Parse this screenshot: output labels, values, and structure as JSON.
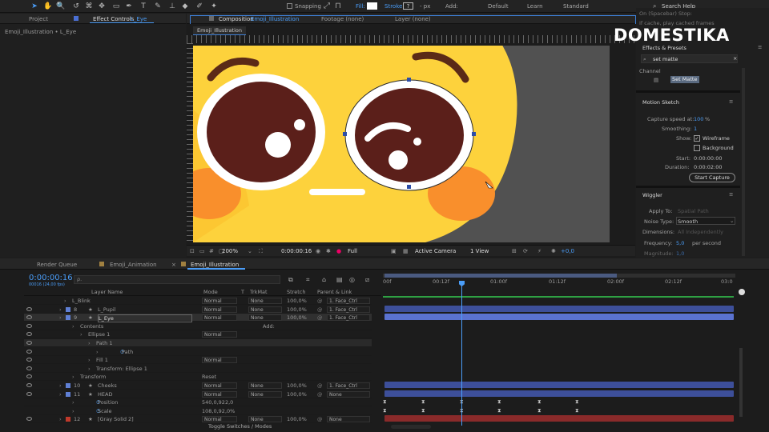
{
  "toolbar": {
    "snapping": "Snapping",
    "fill": "Fill:",
    "stroke": "Stroke:",
    "stroke_val": "?",
    "px": "- px",
    "add": "Add:",
    "workspaces": [
      "Default",
      "Learn",
      "Standard"
    ],
    "search": "Search Help"
  },
  "left_panel": {
    "tab_project": "Project",
    "tab_effect": "Effect Controls",
    "tab_effect_layer": "L_Eye",
    "breadcrumb": "Emoji_Illustration • L_Eye"
  },
  "comp_panel": {
    "tab_comp": "Composition",
    "comp_name": "Emoji_Illustration",
    "tab_footage": "Footage (none)",
    "tab_layer": "Layer (none)",
    "subtab": "Emoji_Illustration",
    "zoom": "200%",
    "time": "0:00:00:16",
    "res": "Full",
    "camera": "Active Camera",
    "view": "1 View",
    "exposure": "+0,0"
  },
  "right_panel": {
    "header1": "On (Spacebar) Stop:",
    "header2": "If cache, play cached frames",
    "logo": "DOMESTIKA",
    "effects_title": "Effects & Presets",
    "search_val": "set matte",
    "channel": "Channel",
    "set_matte": "Set Matte",
    "motion_sketch": {
      "title": "Motion Sketch",
      "capture_speed_label": "Capture speed at:",
      "capture_speed_val": "100",
      "capture_speed_unit": "%",
      "smoothing_label": "Smoothing:",
      "smoothing_val": "1",
      "show_label": "Show:",
      "wireframe": "Wireframe",
      "background": "Background",
      "start_label": "Start:",
      "start_val": "0:00:00:00",
      "duration_label": "Duration:",
      "duration_val": "0:00:02:00",
      "button": "Start Capture"
    },
    "wiggler": {
      "title": "Wiggler",
      "apply_label": "Apply To:",
      "apply_val": "Spatial Path",
      "noise_label": "Noise Type:",
      "noise_val": "Smooth",
      "dim_label": "Dimensions:",
      "dim_val": "All Independently",
      "freq_label": "Frequency:",
      "freq_val": "5,0",
      "freq_unit": "per second",
      "mag_label": "Magnitude:",
      "mag_val": "1,0"
    }
  },
  "timeline": {
    "tabs": [
      "Render Queue",
      "Emoji_Animation",
      "Emoji_Illustration"
    ],
    "timecode": "0:00:00:16",
    "fps": "00016 (24,00 fps)",
    "search_placeholder": "ρ.",
    "headers": {
      "layer_name": "Layer Name",
      "mode": "Mode",
      "t": "T",
      "trkmat": "TrkMat",
      "stretch": "Stretch",
      "parent": "Parent & Link"
    },
    "ruler": [
      "00f",
      "00:12f",
      "01:00f",
      "01:12f",
      "02:00f",
      "02:12f",
      "03:0"
    ],
    "footer": "Toggle Switches / Modes",
    "rows": [
      {
        "num": "",
        "name": "L_Blink",
        "mode": "Normal",
        "trk": "None",
        "stretch": "100,0%",
        "parent": "1. Face_Ctrl",
        "color": "#5f7fd4"
      },
      {
        "num": "8",
        "name": "L_Pupil",
        "mode": "Normal",
        "trk": "None",
        "stretch": "100,0%",
        "parent": "1. Face_Ctrl",
        "color": "#5f7fd4"
      },
      {
        "num": "9",
        "name": "L_Eye",
        "mode": "Normal",
        "trk": "None",
        "stretch": "100,0%",
        "parent": "1. Face_Ctrl",
        "color": "#5f7fd4"
      },
      {
        "num": "",
        "name": "Contents",
        "mode": "",
        "add": "Add:"
      },
      {
        "num": "",
        "name": "Ellipse 1",
        "mode": "Normal"
      },
      {
        "num": "",
        "name": "Path 1",
        "mode": ""
      },
      {
        "num": "",
        "name": "Path",
        "mode": ""
      },
      {
        "num": "",
        "name": "Fill 1",
        "mode": "Normal"
      },
      {
        "num": "",
        "name": "Transform: Ellipse 1",
        "mode": ""
      },
      {
        "num": "",
        "name": "Transform",
        "mode": "",
        "reset": "Reset"
      },
      {
        "num": "10",
        "name": "Cheeks",
        "mode": "Normal",
        "trk": "None",
        "stretch": "100,0%",
        "parent": "1. Face_Ctrl",
        "color": "#5f7fd4"
      },
      {
        "num": "11",
        "name": "HEAD",
        "mode": "Normal",
        "trk": "None",
        "stretch": "100,0%",
        "parent": "None",
        "color": "#5f7fd4"
      },
      {
        "num": "",
        "name": "Position",
        "mode": "",
        "val": "540,0,922,0"
      },
      {
        "num": "",
        "name": "Scale",
        "mode": "",
        "val": "108,0,92,0%"
      },
      {
        "num": "12",
        "name": "[Gray Solid 2]",
        "mode": "Normal",
        "trk": "None",
        "stretch": "100,0%",
        "parent": "None",
        "color": "#c0392b"
      }
    ]
  }
}
